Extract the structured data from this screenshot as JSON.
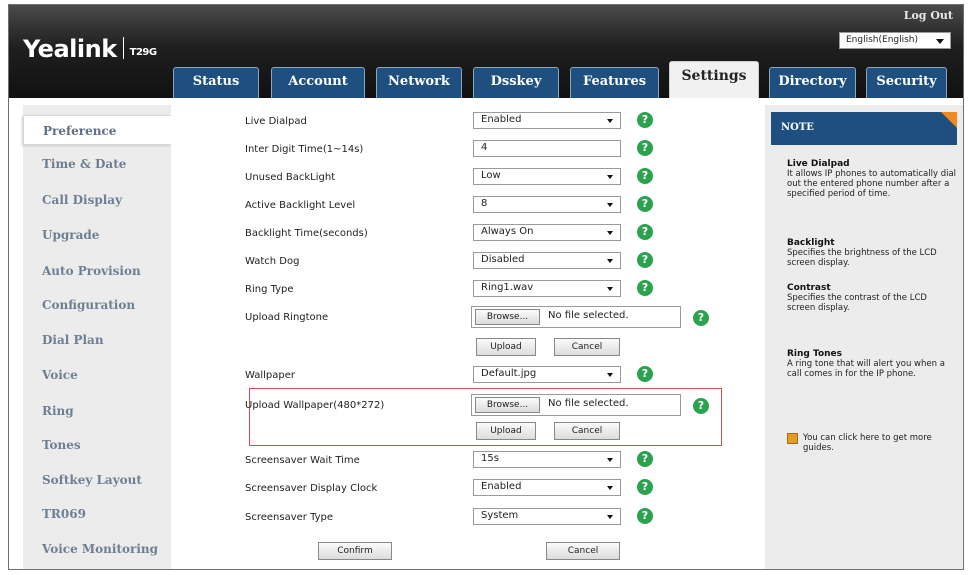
{
  "header": {
    "brand": "Yealink",
    "model": "T29G",
    "logout_label": "Log Out",
    "language": "English(English)"
  },
  "tabs": [
    {
      "label": "Status",
      "active": false
    },
    {
      "label": "Account",
      "active": false
    },
    {
      "label": "Network",
      "active": false
    },
    {
      "label": "Dsskey",
      "active": false
    },
    {
      "label": "Features",
      "active": false
    },
    {
      "label": "Settings",
      "active": true
    },
    {
      "label": "Directory",
      "active": false
    },
    {
      "label": "Security",
      "active": false
    }
  ],
  "sidebar": {
    "items": [
      {
        "label": "Preference",
        "active": true
      },
      {
        "label": "Time & Date"
      },
      {
        "label": "Call Display"
      },
      {
        "label": "Upgrade"
      },
      {
        "label": "Auto Provision"
      },
      {
        "label": "Configuration"
      },
      {
        "label": "Dial Plan"
      },
      {
        "label": "Voice"
      },
      {
        "label": "Ring"
      },
      {
        "label": "Tones"
      },
      {
        "label": "Softkey Layout"
      },
      {
        "label": "TR069"
      },
      {
        "label": "Voice Monitoring"
      }
    ]
  },
  "form": {
    "live_dialpad": {
      "label": "Live Dialpad",
      "value": "Enabled"
    },
    "inter_digit_time": {
      "label": "Inter Digit Time(1~14s)",
      "value": "4"
    },
    "unused_backlight": {
      "label": "Unused BackLight",
      "value": "Low"
    },
    "active_backlight_level": {
      "label": "Active Backlight Level",
      "value": "8"
    },
    "backlight_time": {
      "label": "Backlight Time(seconds)",
      "value": "Always On"
    },
    "watch_dog": {
      "label": "Watch Dog",
      "value": "Disabled"
    },
    "ring_type": {
      "label": "Ring Type",
      "value": "Ring1.wav"
    },
    "upload_ringtone": {
      "label": "Upload Ringtone",
      "browse": "Browse...",
      "status": "No file selected.",
      "upload": "Upload",
      "cancel": "Cancel"
    },
    "wallpaper": {
      "label": "Wallpaper",
      "value": "Default.jpg"
    },
    "upload_wallpaper": {
      "label": "Upload Wallpaper(480*272)",
      "browse": "Browse...",
      "status": "No file selected.",
      "upload": "Upload",
      "cancel": "Cancel"
    },
    "screensaver_wait_time": {
      "label": "Screensaver Wait Time",
      "value": "15s"
    },
    "screensaver_display_clock": {
      "label": "Screensaver Display Clock",
      "value": "Enabled"
    },
    "screensaver_type": {
      "label": "Screensaver Type",
      "value": "System"
    },
    "help_glyph": "?",
    "confirm": "Confirm",
    "cancel": "Cancel"
  },
  "note": {
    "title": "NOTE",
    "sections": [
      {
        "heading": "Live Dialpad",
        "text": "It allows IP phones to automatically dial out the entered phone number after a specified period of time."
      },
      {
        "heading": "Backlight",
        "text": "Specifies the brightness of the LCD screen display."
      },
      {
        "heading": "Contrast",
        "text": "Specifies the contrast of the LCD screen display."
      },
      {
        "heading": "Ring Tones",
        "text": "A ring tone that will alert you when a call comes in for the IP phone."
      }
    ],
    "guide": "You can click here to get more guides."
  },
  "colors": {
    "accent": "#1f4f7e",
    "help": "#2ca14e",
    "highlight": "#d94a4a",
    "note_corner": "#f08a1e"
  }
}
